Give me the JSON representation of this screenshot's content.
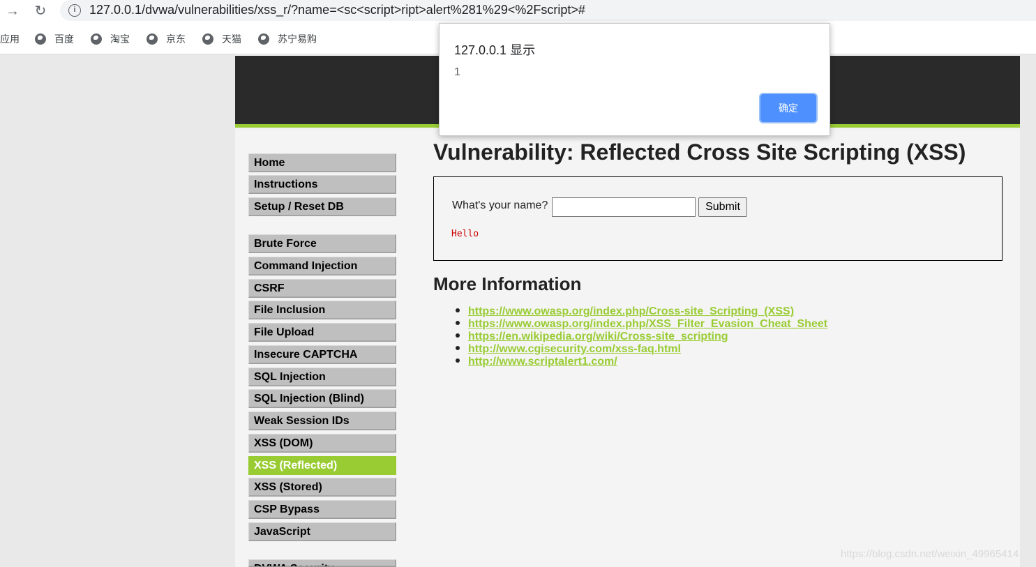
{
  "browser": {
    "url": "127.0.0.1/dvwa/vulnerabilities/xss_r/?name=<sc<script>ript>alert%281%29<%2Fscript>#",
    "bookmarks": [
      {
        "label": "应用"
      },
      {
        "label": "百度"
      },
      {
        "label": "淘宝"
      },
      {
        "label": "京东"
      },
      {
        "label": "天猫"
      },
      {
        "label": "苏宁易购"
      }
    ]
  },
  "sidebar": {
    "items": [
      {
        "label": "Home"
      },
      {
        "label": "Instructions"
      },
      {
        "label": "Setup / Reset DB"
      },
      {
        "label": "Brute Force"
      },
      {
        "label": "Command Injection"
      },
      {
        "label": "CSRF"
      },
      {
        "label": "File Inclusion"
      },
      {
        "label": "File Upload"
      },
      {
        "label": "Insecure CAPTCHA"
      },
      {
        "label": "SQL Injection"
      },
      {
        "label": "SQL Injection (Blind)"
      },
      {
        "label": "Weak Session IDs"
      },
      {
        "label": "XSS (DOM)"
      },
      {
        "label": "XSS (Reflected)",
        "active": true
      },
      {
        "label": "XSS (Stored)"
      },
      {
        "label": "CSP Bypass"
      },
      {
        "label": "JavaScript"
      },
      {
        "label": "DVWA Security"
      }
    ]
  },
  "main": {
    "title": "Vulnerability: Reflected Cross Site Scripting (XSS)",
    "form": {
      "label": "What's your name?",
      "input_value": "",
      "submit_label": "Submit"
    },
    "output": "Hello",
    "more_info_title": "More Information",
    "links": [
      "https://www.owasp.org/index.php/Cross-site_Scripting_(XSS)",
      "https://www.owasp.org/index.php/XSS_Filter_Evasion_Cheat_Sheet",
      "https://en.wikipedia.org/wiki/Cross-site_scripting",
      "http://www.cgisecurity.com/xss-faq.html",
      "http://www.scriptalert1.com/"
    ]
  },
  "alert": {
    "title": "127.0.0.1 显示",
    "message": "1",
    "ok_label": "确定"
  },
  "watermark": "https://blog.csdn.net/weixin_49965414",
  "colors": {
    "accent": "#99cc33",
    "header_bg": "#2a2a2a",
    "output_text": "#cc0000",
    "dialog_button": "#4d90fe"
  }
}
